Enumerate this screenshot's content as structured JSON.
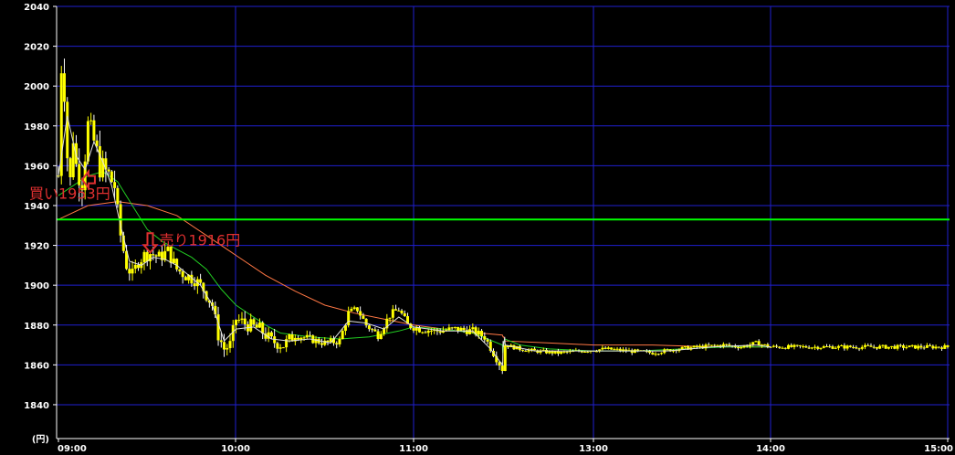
{
  "chart_data": {
    "type": "candlestick",
    "unit_label": "(円)",
    "x_ticks": [
      "09:00",
      "10:00",
      "11:00",
      "13:00",
      "14:00",
      "15:00"
    ],
    "y_ticks": [
      1840,
      1860,
      1880,
      1900,
      1920,
      1940,
      1960,
      1980,
      2000,
      2020,
      2040
    ],
    "ylim": [
      1823,
      2040
    ],
    "grid": true,
    "reference_line": {
      "value": 1933,
      "color": "#00ff00"
    },
    "annotations": [
      {
        "label": "買い1953円",
        "price": 1953,
        "time": "09:08",
        "marker": "left-arrow"
      },
      {
        "label": "売り1916円",
        "price": 1916,
        "time": "09:31",
        "marker": "down-arrow"
      }
    ],
    "colors": {
      "background": "#000000",
      "grid": "#1f1fd0",
      "axis": "#ffffff",
      "candle_up": "#ffff00",
      "candle_down": "#ffffff",
      "ma_short": "#e0e0e0",
      "ma_medium": "#22cc22",
      "ma_long": "#ff7744",
      "annotation": "#e03030"
    },
    "price_path": [
      [
        "09:00",
        1955
      ],
      [
        "09:01",
        2010
      ],
      [
        "09:02",
        1998
      ],
      [
        "09:03",
        1965
      ],
      [
        "09:04",
        1952
      ],
      [
        "09:05",
        1975
      ],
      [
        "09:06",
        1960
      ],
      [
        "09:08",
        1953
      ],
      [
        "09:10",
        1980
      ],
      [
        "09:12",
        1972
      ],
      [
        "09:14",
        1960
      ],
      [
        "09:17",
        1955
      ],
      [
        "09:19",
        1950
      ],
      [
        "09:21",
        1925
      ],
      [
        "09:23",
        1910
      ],
      [
        "09:25",
        1905
      ],
      [
        "09:27",
        1912
      ],
      [
        "09:29",
        1915
      ],
      [
        "09:31",
        1916
      ],
      [
        "09:34",
        1914
      ],
      [
        "09:37",
        1917
      ],
      [
        "09:40",
        1908
      ],
      [
        "09:43",
        1905
      ],
      [
        "09:46",
        1903
      ],
      [
        "09:49",
        1898
      ],
      [
        "09:52",
        1890
      ],
      [
        "09:54",
        1875
      ],
      [
        "09:56",
        1868
      ],
      [
        "09:58",
        1870
      ],
      [
        "10:00",
        1883
      ],
      [
        "10:04",
        1880
      ],
      [
        "10:08",
        1878
      ],
      [
        "10:12",
        1872
      ],
      [
        "10:16",
        1870
      ],
      [
        "10:20",
        1875
      ],
      [
        "10:25",
        1873
      ],
      [
        "10:30",
        1871
      ],
      [
        "10:35",
        1872
      ],
      [
        "10:38",
        1886
      ],
      [
        "10:41",
        1888
      ],
      [
        "10:44",
        1880
      ],
      [
        "10:48",
        1875
      ],
      [
        "10:52",
        1885
      ],
      [
        "10:55",
        1888
      ],
      [
        "10:58",
        1880
      ],
      [
        "11:02",
        1878
      ],
      [
        "11:08",
        1877
      ],
      [
        "11:14",
        1878
      ],
      [
        "11:20",
        1877
      ],
      [
        "11:24",
        1874
      ],
      [
        "11:27",
        1866
      ],
      [
        "11:30",
        1858
      ],
      [
        "11:33",
        1860
      ],
      [
        "11:36",
        1857
      ],
      [
        "11:39",
        1862
      ],
      [
        "11:42",
        1873
      ],
      [
        "11:46",
        1875
      ],
      [
        "11:50",
        1868
      ],
      [
        "11:55",
        1873
      ],
      [
        "12:00",
        1870
      ],
      [
        "12:05",
        1868
      ],
      [
        "12:10",
        1873
      ],
      [
        "12:15",
        1874
      ],
      [
        "12:20",
        1876
      ],
      [
        "12:25",
        1873
      ],
      [
        "12:30",
        1870
      ],
      [
        "12:35",
        1868
      ],
      [
        "12:40",
        1867
      ],
      [
        "12:48",
        1866
      ],
      [
        "12:56",
        1867
      ],
      [
        "13:04",
        1868
      ],
      [
        "13:12",
        1867
      ],
      [
        "13:20",
        1866
      ],
      [
        "13:28",
        1868
      ],
      [
        "13:36",
        1869
      ],
      [
        "13:44",
        1870
      ],
      [
        "13:50",
        1869
      ],
      [
        "13:55",
        1871
      ],
      [
        "14:00",
        1869
      ]
    ],
    "ma_short": [
      [
        "09:00",
        1955
      ],
      [
        "09:03",
        1985
      ],
      [
        "09:06",
        1965
      ],
      [
        "09:09",
        1958
      ],
      [
        "09:12",
        1972
      ],
      [
        "09:15",
        1962
      ],
      [
        "09:18",
        1950
      ],
      [
        "09:21",
        1930
      ],
      [
        "09:24",
        1912
      ],
      [
        "09:28",
        1910
      ],
      [
        "09:32",
        1914
      ],
      [
        "09:36",
        1913
      ],
      [
        "09:40",
        1910
      ],
      [
        "09:44",
        1905
      ],
      [
        "09:48",
        1900
      ],
      [
        "09:52",
        1890
      ],
      [
        "09:56",
        1872
      ],
      [
        "10:00",
        1878
      ],
      [
        "10:06",
        1879
      ],
      [
        "10:12",
        1873
      ],
      [
        "10:18",
        1872
      ],
      [
        "10:25",
        1873
      ],
      [
        "10:32",
        1871
      ],
      [
        "10:38",
        1882
      ],
      [
        "10:44",
        1881
      ],
      [
        "10:50",
        1878
      ],
      [
        "10:55",
        1884
      ],
      [
        "11:00",
        1879
      ],
      [
        "11:10",
        1877
      ],
      [
        "11:20",
        1877
      ],
      [
        "11:26",
        1868
      ],
      [
        "11:32",
        1860
      ],
      [
        "11:38",
        1861
      ],
      [
        "11:44",
        1872
      ],
      [
        "11:50",
        1869
      ],
      [
        "12:00",
        1871
      ],
      [
        "12:10",
        1872
      ],
      [
        "12:20",
        1874
      ],
      [
        "12:30",
        1870
      ],
      [
        "12:40",
        1867
      ],
      [
        "12:55",
        1867
      ],
      [
        "13:10",
        1867
      ],
      [
        "13:25",
        1867
      ],
      [
        "13:40",
        1869
      ],
      [
        "13:55",
        1870
      ],
      [
        "14:00",
        1869
      ]
    ],
    "ma_medium": [
      [
        "09:00",
        1945
      ],
      [
        "09:05",
        1950
      ],
      [
        "09:10",
        1955
      ],
      [
        "09:15",
        1957
      ],
      [
        "09:20",
        1952
      ],
      [
        "09:25",
        1940
      ],
      [
        "09:30",
        1928
      ],
      [
        "09:35",
        1922
      ],
      [
        "09:40",
        1918
      ],
      [
        "09:45",
        1914
      ],
      [
        "09:50",
        1908
      ],
      [
        "09:55",
        1898
      ],
      [
        "10:00",
        1890
      ],
      [
        "10:05",
        1885
      ],
      [
        "10:10",
        1880
      ],
      [
        "10:15",
        1876
      ],
      [
        "10:25",
        1874
      ],
      [
        "10:35",
        1873
      ],
      [
        "10:45",
        1874
      ],
      [
        "10:55",
        1877
      ],
      [
        "11:00",
        1879
      ],
      [
        "11:10",
        1878
      ],
      [
        "11:20",
        1876
      ],
      [
        "11:30",
        1870
      ],
      [
        "11:38",
        1866
      ],
      [
        "11:46",
        1868
      ],
      [
        "11:55",
        1870
      ],
      [
        "12:05",
        1871
      ],
      [
        "12:15",
        1873
      ],
      [
        "12:25",
        1873
      ],
      [
        "12:35",
        1870
      ],
      [
        "12:45",
        1868
      ],
      [
        "13:00",
        1867
      ],
      [
        "13:15",
        1867
      ],
      [
        "13:30",
        1868
      ],
      [
        "13:45",
        1869
      ],
      [
        "14:00",
        1869
      ]
    ],
    "ma_long": [
      [
        "09:00",
        1933
      ],
      [
        "09:10",
        1940
      ],
      [
        "09:20",
        1942
      ],
      [
        "09:30",
        1940
      ],
      [
        "09:40",
        1935
      ],
      [
        "09:50",
        1925
      ],
      [
        "10:00",
        1915
      ],
      [
        "10:10",
        1905
      ],
      [
        "10:20",
        1897
      ],
      [
        "10:30",
        1890
      ],
      [
        "10:40",
        1886
      ],
      [
        "10:50",
        1883
      ],
      [
        "11:00",
        1880
      ],
      [
        "11:15",
        1877
      ],
      [
        "11:30",
        1875
      ],
      [
        "11:45",
        1874
      ],
      [
        "12:00",
        1874
      ],
      [
        "12:15",
        1873
      ],
      [
        "12:30",
        1872
      ],
      [
        "12:45",
        1871
      ],
      [
        "13:00",
        1870
      ],
      [
        "13:20",
        1870
      ],
      [
        "13:40",
        1869
      ],
      [
        "14:00",
        1869
      ]
    ]
  }
}
